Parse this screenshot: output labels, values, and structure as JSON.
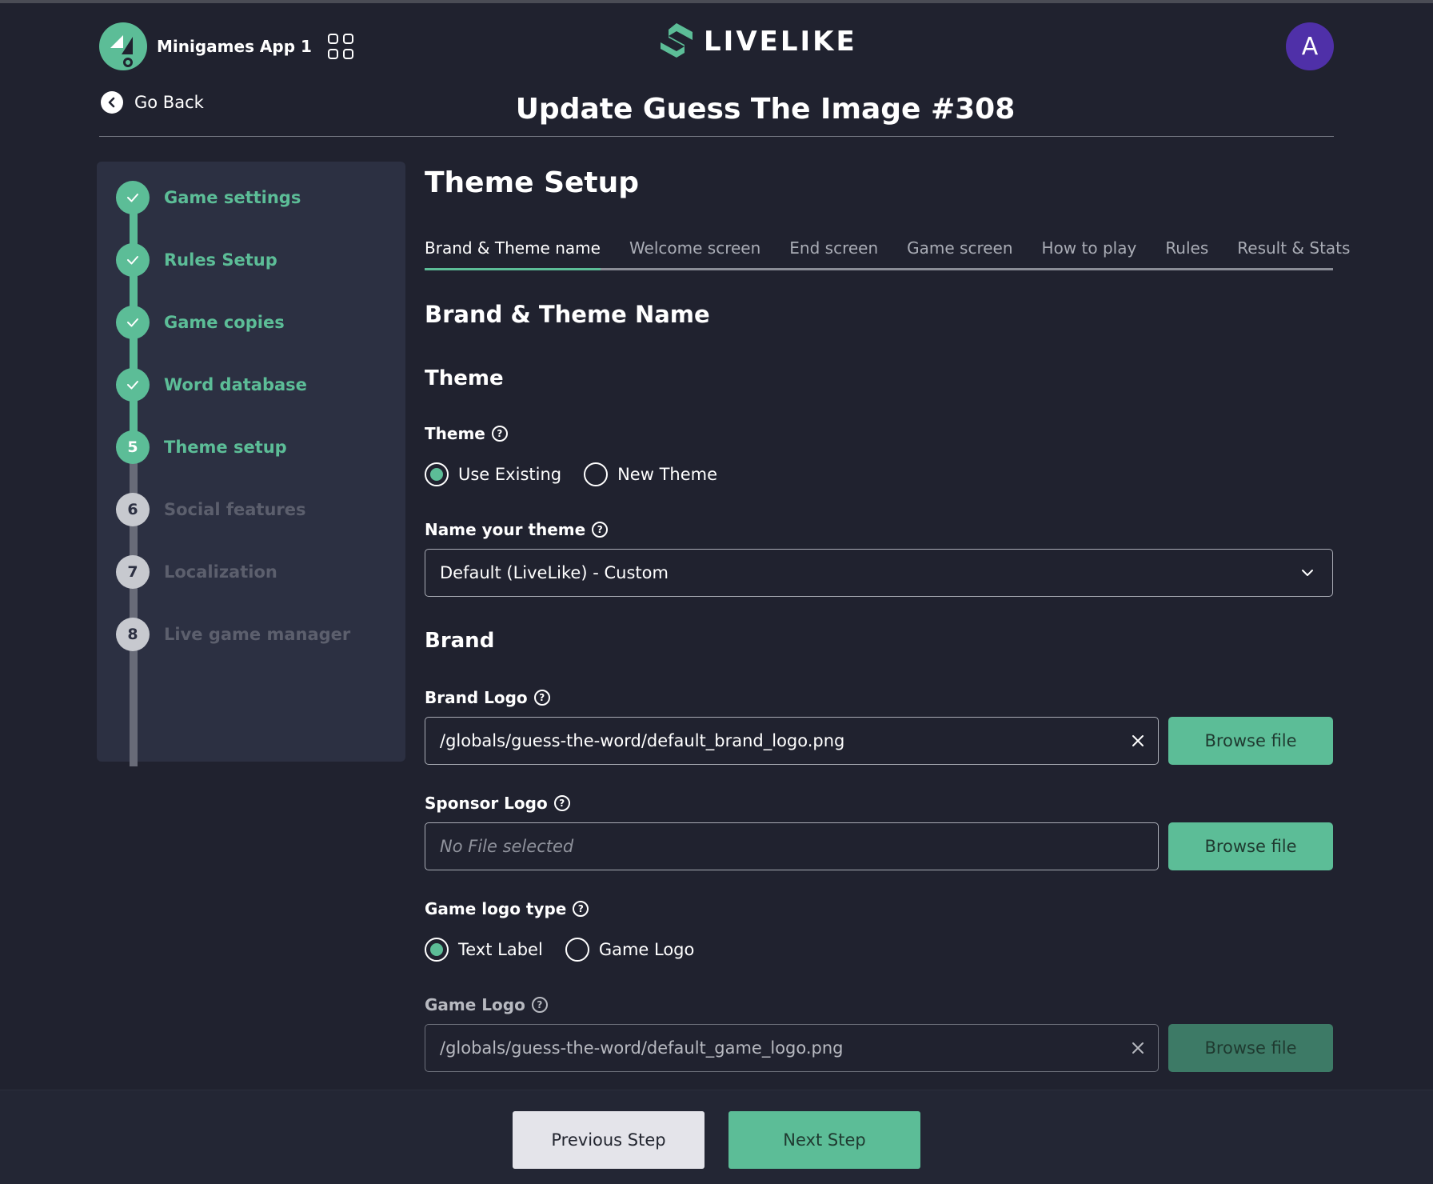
{
  "header": {
    "app_name": "Minigames App 1",
    "brand_name": "LIVELIKE",
    "avatar_initial": "A",
    "go_back": "Go Back",
    "page_title": "Update Guess The Image #308"
  },
  "sidebar": {
    "steps": [
      {
        "number": "",
        "label": "Game settings",
        "status": "done"
      },
      {
        "number": "",
        "label": "Rules Setup",
        "status": "done"
      },
      {
        "number": "",
        "label": "Game copies",
        "status": "done"
      },
      {
        "number": "",
        "label": "Word database",
        "status": "done"
      },
      {
        "number": "5",
        "label": "Theme setup",
        "status": "active"
      },
      {
        "number": "6",
        "label": "Social features",
        "status": "todo"
      },
      {
        "number": "7",
        "label": "Localization",
        "status": "todo"
      },
      {
        "number": "8",
        "label": "Live game manager",
        "status": "todo"
      }
    ]
  },
  "main": {
    "section_title": "Theme Setup",
    "tabs": [
      {
        "label": "Brand & Theme name",
        "active": true
      },
      {
        "label": "Welcome screen",
        "active": false
      },
      {
        "label": "End screen",
        "active": false
      },
      {
        "label": "Game screen",
        "active": false
      },
      {
        "label": "How to play",
        "active": false
      },
      {
        "label": "Rules",
        "active": false
      },
      {
        "label": "Result & Stats",
        "active": false
      }
    ],
    "subsection_title": "Brand & Theme Name",
    "theme_heading": "Theme",
    "theme_label": "Theme",
    "theme_options": [
      {
        "label": "Use Existing",
        "selected": true
      },
      {
        "label": "New Theme",
        "selected": false
      }
    ],
    "name_theme_label": "Name your theme",
    "theme_select_value": "Default (LiveLike) - Custom",
    "brand_heading": "Brand",
    "brand_logo_label": "Brand Logo",
    "brand_logo_value": "/globals/guess-the-word/default_brand_logo.png",
    "sponsor_logo_label": "Sponsor Logo",
    "sponsor_logo_placeholder": "No File selected",
    "game_logo_type_label": "Game logo type",
    "game_logo_type_options": [
      {
        "label": "Text Label",
        "selected": true
      },
      {
        "label": "Game Logo",
        "selected": false
      }
    ],
    "game_logo_label": "Game Logo",
    "game_logo_value": "/globals/guess-the-word/default_game_logo.png",
    "browse_label": "Browse file",
    "help_glyph": "?"
  },
  "footer": {
    "previous_label": "Previous Step",
    "next_label": "Next Step"
  },
  "colors": {
    "background": "#20222f",
    "accent": "#5cbd97",
    "sidebar": "#2c3042",
    "avatar": "#4f30a8"
  }
}
